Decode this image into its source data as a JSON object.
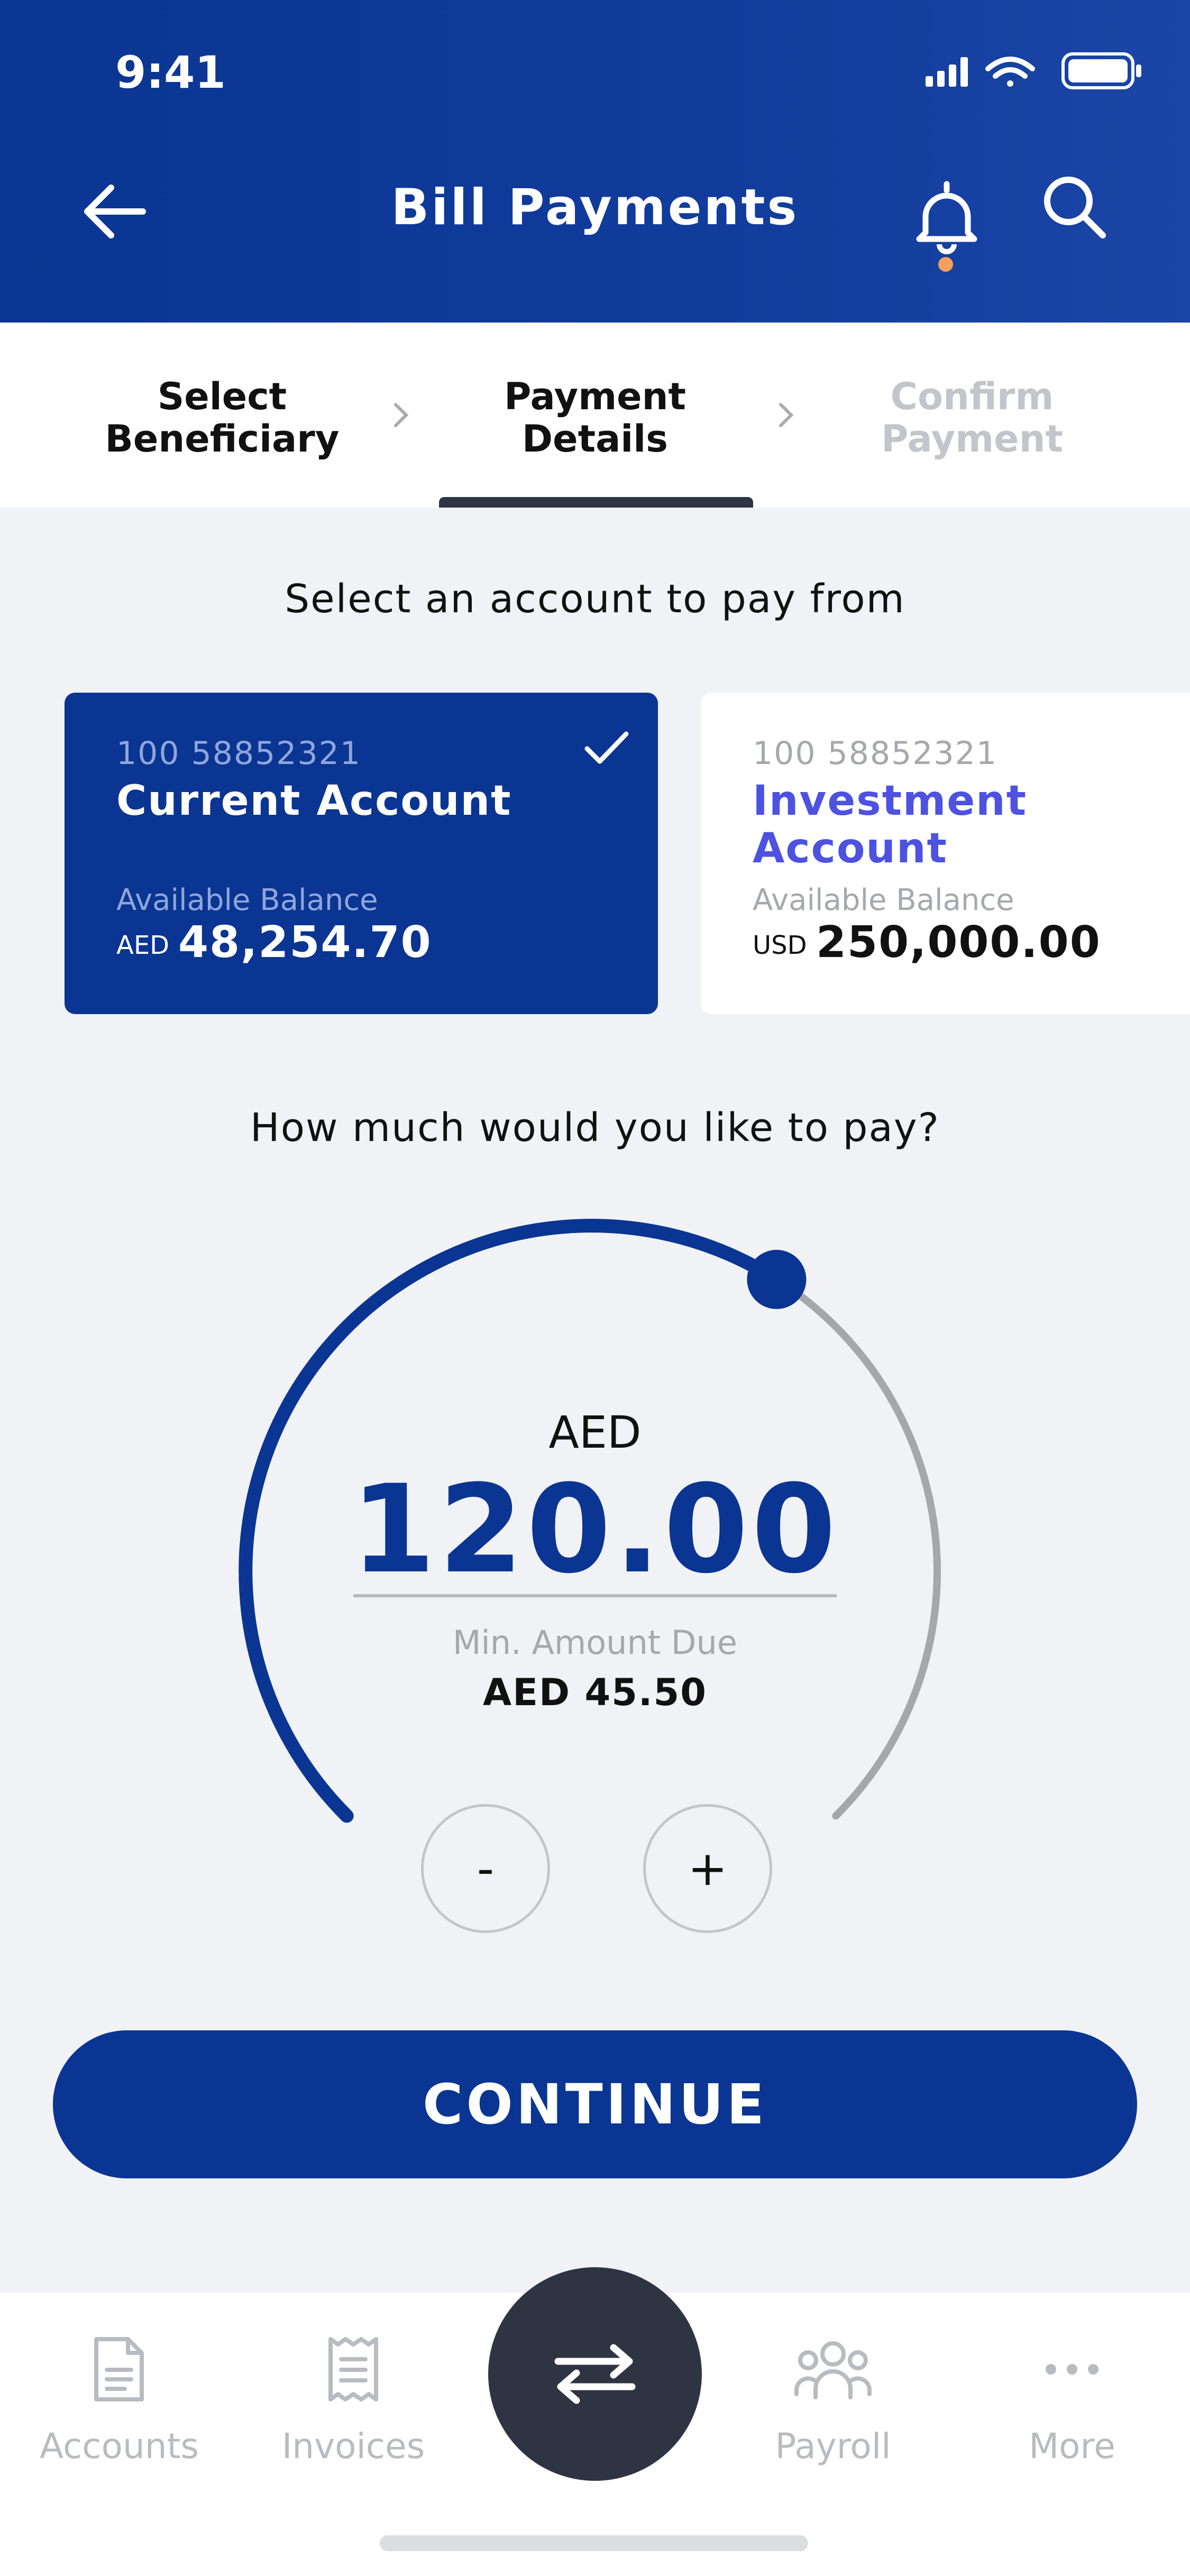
{
  "status_bar": {
    "time": "9:41"
  },
  "header": {
    "title": "Bill Payments"
  },
  "steps": [
    {
      "label": "Select Beneficiary"
    },
    {
      "label": "Payment Details"
    },
    {
      "label": "Confirm Payment"
    }
  ],
  "accounts_section": {
    "label": "Select an account to pay from"
  },
  "accounts": [
    {
      "number": "100 58852321",
      "name": "Current Account",
      "balance_label": "Available Balance",
      "currency": "AED",
      "balance": "48,254.70",
      "selected": true
    },
    {
      "number": "100 58852321",
      "name": "Investment Account",
      "balance_label": "Available Balance",
      "currency": "USD",
      "balance": "250,000.00",
      "selected": false
    }
  ],
  "amount_section": {
    "label": "How much would you like to pay?",
    "currency": "AED",
    "value": "120.00",
    "min_label": "Min. Amount Due",
    "min_value": "AED 45.50",
    "dial_fraction": 0.62,
    "decrement_label": "-",
    "increment_label": "+"
  },
  "continue_label": "CONTINUE",
  "tabbar": [
    {
      "label": "Accounts",
      "icon": "document-icon"
    },
    {
      "label": "Invoices",
      "icon": "receipt-icon"
    },
    {
      "label": "",
      "icon": "transfer-icon"
    },
    {
      "label": "Payroll",
      "icon": "people-icon"
    },
    {
      "label": "More",
      "icon": "more-icon"
    }
  ],
  "colors": {
    "primary": "#0a3592",
    "accent_dot": "#f2a25c",
    "link": "#4d52e0",
    "fab": "#2e3442"
  }
}
